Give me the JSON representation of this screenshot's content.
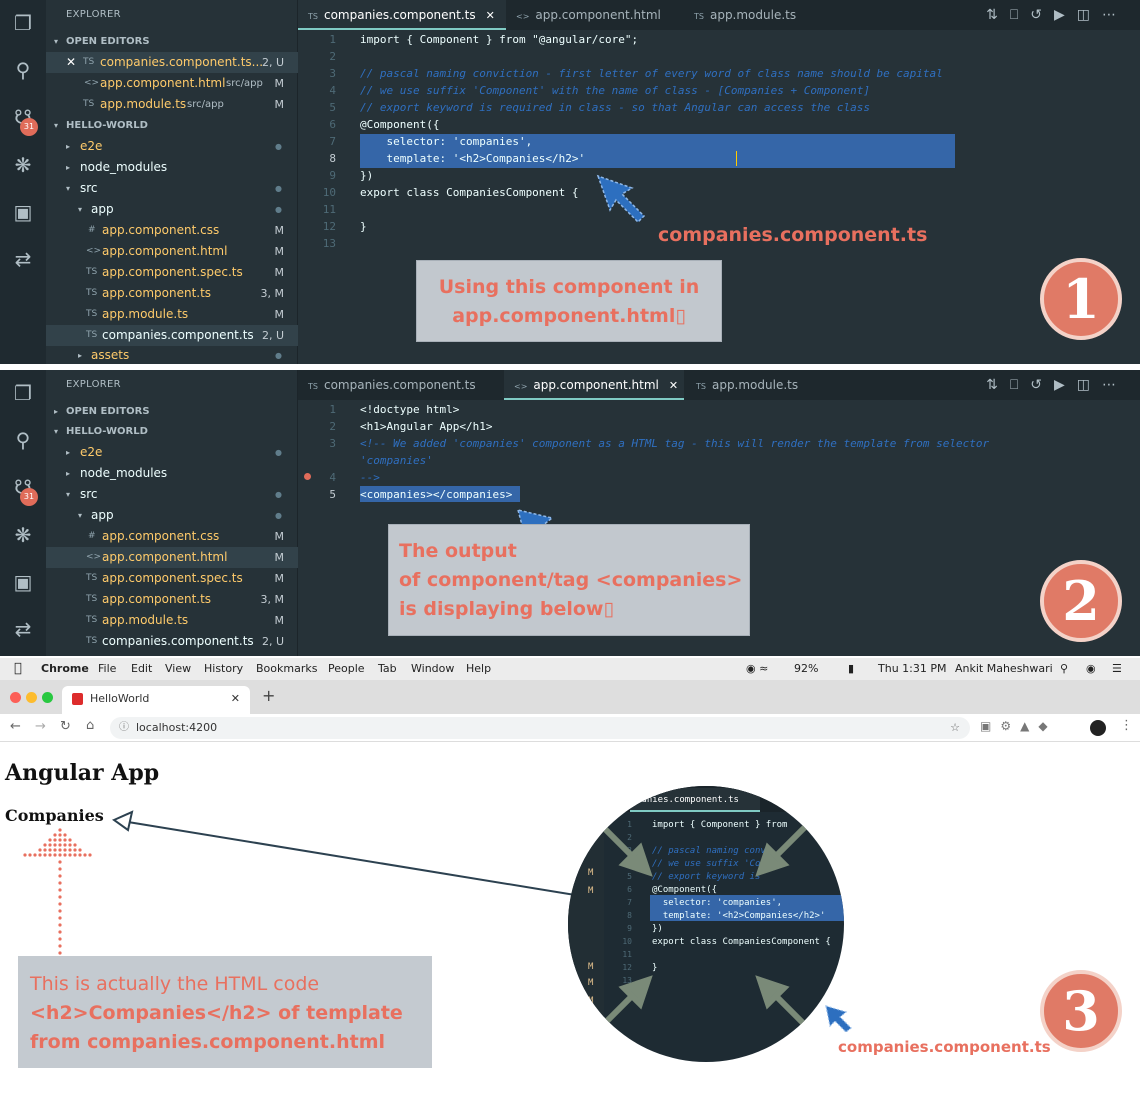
{
  "panel1": {
    "explorer_title": "EXPLORER",
    "open_editors": "OPEN EDITORS",
    "open_files": [
      {
        "icon": "TS",
        "name": "companies.component.ts...",
        "status": "2, U",
        "close": "✕"
      },
      {
        "icon": "<>",
        "name": "app.component.html",
        "path": "src/app",
        "status": "M"
      },
      {
        "icon": "TS",
        "name": "app.module.ts",
        "path": "src/app",
        "status": "M"
      }
    ],
    "workspace": "HELLO-WORLD",
    "tree": [
      {
        "name": "e2e",
        "type": "folder"
      },
      {
        "name": "node_modules",
        "type": "folder"
      },
      {
        "name": "src",
        "type": "folder-open"
      },
      {
        "name": "app",
        "type": "folder-open"
      },
      {
        "icon": "#",
        "name": "app.component.css",
        "status": "M"
      },
      {
        "icon": "<>",
        "name": "app.component.html",
        "status": "M"
      },
      {
        "icon": "TS",
        "name": "app.component.spec.ts",
        "status": "M"
      },
      {
        "icon": "TS",
        "name": "app.component.ts",
        "status": "3, M"
      },
      {
        "icon": "TS",
        "name": "app.module.ts",
        "status": "M"
      },
      {
        "icon": "TS",
        "name": "companies.component.ts",
        "status": "2, U"
      },
      {
        "name": "assets",
        "type": "folder"
      }
    ],
    "tabs": [
      {
        "icon": "TS",
        "label": "companies.component.ts",
        "close": "✕"
      },
      {
        "icon": "<>",
        "label": "app.component.html"
      },
      {
        "icon": "TS",
        "label": "app.module.ts"
      }
    ],
    "badge": "31",
    "lines": [
      "1",
      "2",
      "3",
      "4",
      "5",
      "6",
      "7",
      "8",
      "9",
      "10",
      "11",
      "12",
      "13"
    ],
    "code": [
      "import { Component } from \"@angular/core\";",
      "",
      "// pascal naming conviction - first letter of every word of class name should be capital",
      "// we use suffix 'Component' with the name of class - [Companies + Component]",
      "// export keyword is required in class - so that Angular can access the class",
      "@Component({",
      "    selector: 'companies',",
      "    template: '<h2>Companies</h2>'",
      "})",
      "export class CompaniesComponent {",
      "",
      "}",
      ""
    ],
    "callout_line1": "Using this component in",
    "callout_line2": "app.component.html▯",
    "file_label": "companies.component.ts",
    "number": "1"
  },
  "panel2": {
    "explorer_title": "EXPLORER",
    "open_editors": "OPEN EDITORS",
    "workspace": "HELLO-WORLD",
    "tree": [
      {
        "name": "e2e",
        "type": "folder"
      },
      {
        "name": "node_modules",
        "type": "folder"
      },
      {
        "name": "src",
        "type": "folder-open"
      },
      {
        "name": "app",
        "type": "folder-open"
      },
      {
        "icon": "#",
        "name": "app.component.css",
        "status": "M"
      },
      {
        "icon": "<>",
        "name": "app.component.html",
        "status": "M"
      },
      {
        "icon": "TS",
        "name": "app.component.spec.ts",
        "status": "M"
      },
      {
        "icon": "TS",
        "name": "app.component.ts",
        "status": "3, M"
      },
      {
        "icon": "TS",
        "name": "app.module.ts",
        "status": "M"
      },
      {
        "icon": "TS",
        "name": "companies.component.ts",
        "status": "2, U"
      }
    ],
    "tabs": [
      {
        "icon": "TS",
        "label": "companies.component.ts"
      },
      {
        "icon": "<>",
        "label": "app.component.html",
        "close": "✕"
      },
      {
        "icon": "TS",
        "label": "app.module.ts"
      }
    ],
    "badge": "31",
    "lines": [
      "1",
      "2",
      "3",
      "",
      "4",
      "5"
    ],
    "code": [
      "<!doctype html>",
      "<h1>Angular App</h1>",
      "<!-- We added 'companies' component as a HTML tag - this will render the template from selector",
      "'companies'",
      "-->",
      "<companies></companies>"
    ],
    "callout_line1": "The output",
    "callout_line2": "of component/tag <companies>",
    "callout_line3": "is displaying below▯",
    "number": "2"
  },
  "browser": {
    "menu": [
      "Chrome",
      "File",
      "Edit",
      "View",
      "History",
      "Bookmarks",
      "People",
      "Tab",
      "Window",
      "Help"
    ],
    "battery": "92%",
    "clock": "Thu 1:31 PM",
    "user": "Ankit Maheshwari",
    "tab_title": "HelloWorld",
    "url": "localhost:4200",
    "page_h1": "Angular App",
    "page_h2": "Companies",
    "note_line1": "This is actually the HTML code",
    "note_line2": "<h2>Companies</h2> of template",
    "note_line3": "from companies.component.html",
    "zoom_tab": "panies.component.ts",
    "zoom_lines": [
      "1",
      "2",
      "3",
      "4",
      "5",
      "6",
      "7",
      "8",
      "9",
      "10",
      "11",
      "12",
      "13"
    ],
    "zoom_code": [
      "import { Component } from",
      "",
      "// pascal naming convi",
      "// we use suffix 'Co",
      "// export keyword is",
      "@Component({",
      "  selector: 'companies',",
      "  template: '<h2>Companies</h2>'",
      "})",
      "export class CompaniesComponent {",
      "",
      "}",
      ""
    ],
    "file_label": "companies.component.ts",
    "number": "3"
  },
  "colors": {
    "accent": "#e8705f",
    "editor_bg": "#263238",
    "highlight": "#3566a8",
    "arrow": "#2d6fbf"
  }
}
